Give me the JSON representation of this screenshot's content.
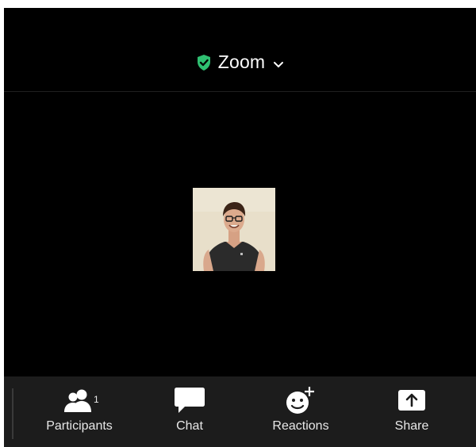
{
  "header": {
    "title": "Zoom",
    "shield_icon": "shield-check-icon",
    "chevron_icon": "chevron-down-icon",
    "shield_color": "#2fbf71"
  },
  "video": {
    "participant_tile": "participant-video-thumbnail"
  },
  "toolbar": {
    "participants": {
      "label": "Participants",
      "count": "1",
      "icon": "participants-icon"
    },
    "chat": {
      "label": "Chat",
      "icon": "chat-bubble-icon"
    },
    "reactions": {
      "label": "Reactions",
      "icon": "reactions-smiley-plus-icon"
    },
    "share": {
      "label": "Share",
      "icon": "share-upload-icon"
    }
  }
}
